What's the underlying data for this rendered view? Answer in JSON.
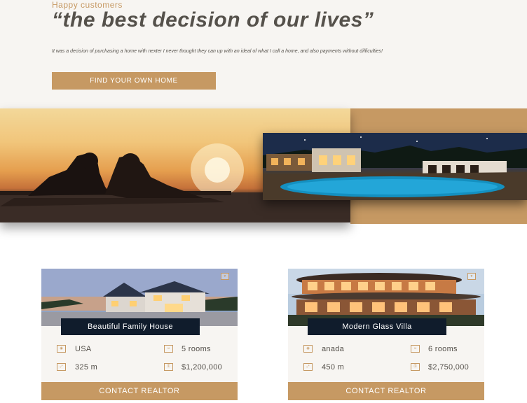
{
  "testimonial": {
    "eyebrow": "Happy customers",
    "quote": "“the best decision of our lives”",
    "text": "It was a decision of purchasing a home with nexter I never thought they can up with an ideal of what I call a home, and also payments without difficulties!",
    "button": "FIND YOUR OWN HOME"
  },
  "colors": {
    "accent": "#c69963",
    "dark": "#101c2c",
    "text": "#55514b",
    "bg": "#f7f5f2"
  },
  "cards": [
    {
      "name": "Beautiful Family House",
      "country": "USA",
      "rooms": "5 rooms",
      "area": "325 m",
      "price": "$1,200,000",
      "button": "CONTACT REALTOR"
    },
    {
      "name": "Modern Glass Villa",
      "country": "anada",
      "rooms": "6 rooms",
      "area": "450 m",
      "price": "$2,750,000",
      "button": "CONTACT REALTOR"
    }
  ],
  "icons": {
    "like": "heart-icon",
    "country": "map-pin-icon",
    "rooms": "user-icon",
    "area": "expand-icon",
    "price": "key-icon"
  }
}
